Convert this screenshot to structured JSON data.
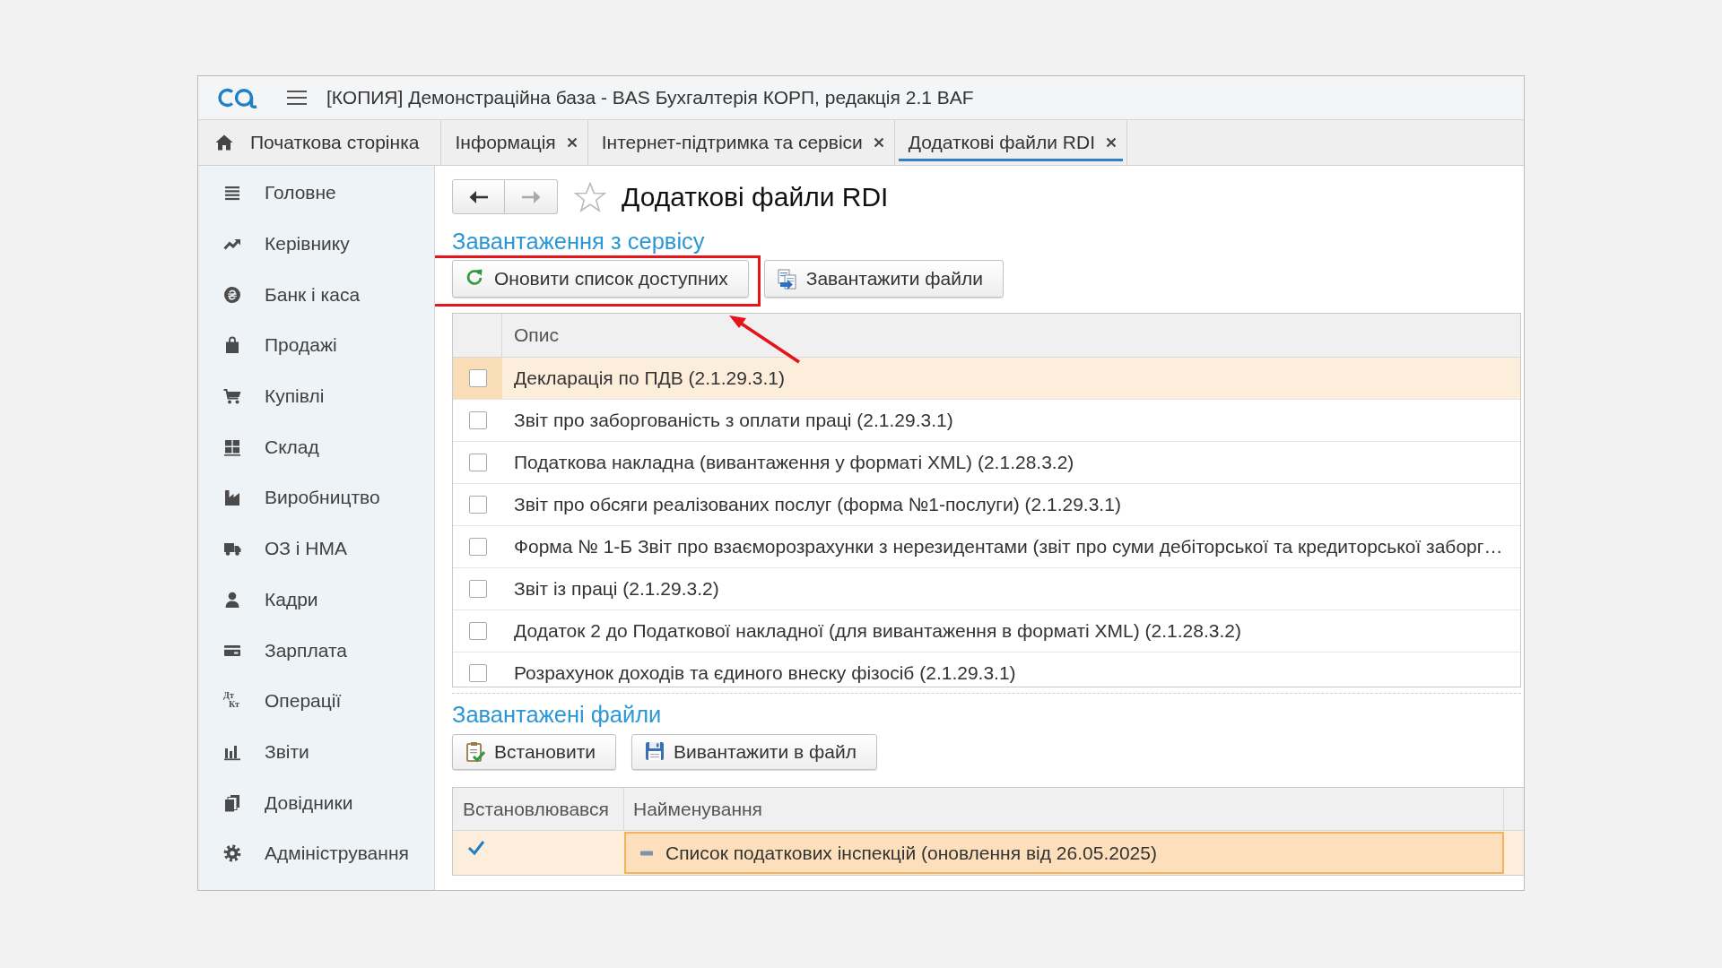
{
  "window": {
    "title": "[КОПИЯ] Демонстраційна база - BAS Бухгалтерія КОРП, редакція 2.1 BAF"
  },
  "tabs": [
    {
      "label": "Початкова сторінка",
      "kind": "home",
      "selected": false
    },
    {
      "label": "Інформація",
      "kind": "closable",
      "selected": false
    },
    {
      "label": "Інтернет-підтримка та сервіси",
      "kind": "closable",
      "selected": false
    },
    {
      "label": "Додаткові файли RDI",
      "kind": "closable",
      "selected": true
    }
  ],
  "sidebar": {
    "items": [
      {
        "label": "Головне"
      },
      {
        "label": "Керівнику"
      },
      {
        "label": "Банк і каса"
      },
      {
        "label": "Продажі"
      },
      {
        "label": "Купівлі"
      },
      {
        "label": "Склад"
      },
      {
        "label": "Виробництво"
      },
      {
        "label": "ОЗ і НМА"
      },
      {
        "label": "Кадри"
      },
      {
        "label": "Зарплата"
      },
      {
        "label": "Операції",
        "icon_text": [
          "Дт",
          "Кт"
        ]
      },
      {
        "label": "Звіти"
      },
      {
        "label": "Довідники"
      },
      {
        "label": "Адміністрування"
      }
    ]
  },
  "page": {
    "title": "Додаткові файли RDI",
    "favorite": false,
    "back_enabled": true,
    "forward_enabled": false
  },
  "service_section": {
    "heading": "Завантаження з сервісу",
    "buttons": [
      {
        "label": "Оновити список доступних",
        "kind": "refresh",
        "highlighted": true
      },
      {
        "label": "Завантажити файли",
        "kind": "download",
        "highlighted": false
      }
    ],
    "table": {
      "columns": [
        "Опис"
      ],
      "rows": [
        {
          "description": "Декларація по ПДВ (2.1.29.3.1)",
          "checked": false,
          "selected": true
        },
        {
          "description": "Звіт про заборгованість з оплати праці (2.1.29.3.1)",
          "checked": false,
          "selected": false
        },
        {
          "description": "Податкова накладна (вивантаження у форматі XML) (2.1.28.3.2)",
          "checked": false,
          "selected": false
        },
        {
          "description": "Звіт про обсяги реалізованих послуг (форма №1-послуги) (2.1.29.3.1)",
          "checked": false,
          "selected": false
        },
        {
          "description": "Форма № 1-Б Звіт про взаєморозрахунки з нерезидентами (звіт про суми дебіторської та кредиторської заборг…",
          "checked": false,
          "selected": false
        },
        {
          "description": "Звіт із праці (2.1.29.3.2)",
          "checked": false,
          "selected": false
        },
        {
          "description": "Додаток 2 до Податкової накладної (для вивантаження в форматі XML) (2.1.28.3.2)",
          "checked": false,
          "selected": false
        },
        {
          "description": "Розрахунок доходів та єдиного внеску фізосіб (2.1.29.3.1)",
          "checked": false,
          "selected": false
        }
      ]
    }
  },
  "uploaded_section": {
    "heading": "Завантажені файли",
    "buttons": [
      {
        "label": "Встановити",
        "kind": "install"
      },
      {
        "label": "Вивантажити в файл",
        "kind": "save"
      }
    ],
    "table": {
      "columns": [
        "Встановлювався",
        "Найменування"
      ],
      "rows": [
        {
          "installed": true,
          "name": "Список податкових інспекцій (оновлення від 26.05.2025)",
          "selected": true
        }
      ]
    }
  }
}
